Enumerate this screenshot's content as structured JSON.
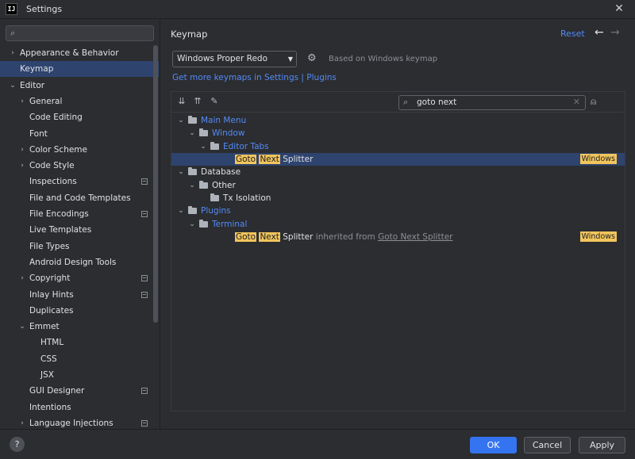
{
  "window": {
    "title": "Settings",
    "logo_text": "IJ",
    "close_glyph": "✕"
  },
  "sidebar": {
    "search_placeholder": "",
    "items": [
      {
        "label": "Appearance & Behavior",
        "level": 0,
        "arrow": "›",
        "badge": false,
        "selected": false
      },
      {
        "label": "Keymap",
        "level": 0,
        "arrow": "",
        "badge": false,
        "selected": true
      },
      {
        "label": "Editor",
        "level": 0,
        "arrow": "⌄",
        "badge": false,
        "selected": false
      },
      {
        "label": "General",
        "level": 1,
        "arrow": "›",
        "badge": false,
        "selected": false
      },
      {
        "label": "Code Editing",
        "level": 1,
        "arrow": "",
        "badge": false,
        "selected": false
      },
      {
        "label": "Font",
        "level": 1,
        "arrow": "",
        "badge": false,
        "selected": false
      },
      {
        "label": "Color Scheme",
        "level": 1,
        "arrow": "›",
        "badge": false,
        "selected": false
      },
      {
        "label": "Code Style",
        "level": 1,
        "arrow": "›",
        "badge": false,
        "selected": false
      },
      {
        "label": "Inspections",
        "level": 1,
        "arrow": "",
        "badge": true,
        "selected": false
      },
      {
        "label": "File and Code Templates",
        "level": 1,
        "arrow": "",
        "badge": false,
        "selected": false
      },
      {
        "label": "File Encodings",
        "level": 1,
        "arrow": "",
        "badge": true,
        "selected": false
      },
      {
        "label": "Live Templates",
        "level": 1,
        "arrow": "",
        "badge": false,
        "selected": false
      },
      {
        "label": "File Types",
        "level": 1,
        "arrow": "",
        "badge": false,
        "selected": false
      },
      {
        "label": "Android Design Tools",
        "level": 1,
        "arrow": "",
        "badge": false,
        "selected": false
      },
      {
        "label": "Copyright",
        "level": 1,
        "arrow": "›",
        "badge": true,
        "selected": false
      },
      {
        "label": "Inlay Hints",
        "level": 1,
        "arrow": "",
        "badge": true,
        "selected": false
      },
      {
        "label": "Duplicates",
        "level": 1,
        "arrow": "",
        "badge": false,
        "selected": false
      },
      {
        "label": "Emmet",
        "level": 1,
        "arrow": "⌄",
        "badge": false,
        "selected": false
      },
      {
        "label": "HTML",
        "level": 2,
        "arrow": "",
        "badge": false,
        "selected": false
      },
      {
        "label": "CSS",
        "level": 2,
        "arrow": "",
        "badge": false,
        "selected": false
      },
      {
        "label": "JSX",
        "level": 2,
        "arrow": "",
        "badge": false,
        "selected": false
      },
      {
        "label": "GUI Designer",
        "level": 1,
        "arrow": "",
        "badge": true,
        "selected": false
      },
      {
        "label": "Intentions",
        "level": 1,
        "arrow": "",
        "badge": false,
        "selected": false
      },
      {
        "label": "Language Injections",
        "level": 1,
        "arrow": "›",
        "badge": true,
        "selected": false
      }
    ]
  },
  "main": {
    "title": "Keymap",
    "reset": "Reset",
    "back_glyph": "←",
    "forward_glyph": "→",
    "keymap_selected": "Windows Proper Redo",
    "based_on": "Based on Windows keymap",
    "more_keymaps": "Get more keymaps in Settings | Plugins",
    "toolbar_icons": [
      "expand-all-icon",
      "collapse-all-icon",
      "edit-icon"
    ],
    "find_value": "goto next",
    "tree": [
      {
        "kind": "folder",
        "level": 0,
        "arrow": "⌄",
        "parts": [
          {
            "t": "Main Menu",
            "c": "blue"
          }
        ],
        "tag": "",
        "folder_icon": "menu"
      },
      {
        "kind": "folder",
        "level": 1,
        "arrow": "⌄",
        "parts": [
          {
            "t": "Window",
            "c": "blue"
          }
        ],
        "tag": ""
      },
      {
        "kind": "folder",
        "level": 2,
        "arrow": "⌄",
        "parts": [
          {
            "t": "Editor Tabs",
            "c": "blue"
          }
        ],
        "tag": ""
      },
      {
        "kind": "action",
        "level": 3,
        "arrow": "",
        "selected": true,
        "parts": [
          {
            "t": "Goto",
            "c": "hl"
          },
          {
            "t": " ",
            "c": ""
          },
          {
            "t": "Next",
            "c": "hl"
          },
          {
            "t": " Splitter",
            "c": ""
          }
        ],
        "tag": "Windows"
      },
      {
        "kind": "folder",
        "level": 0,
        "arrow": "⌄",
        "parts": [
          {
            "t": "Database",
            "c": ""
          }
        ],
        "tag": ""
      },
      {
        "kind": "folder",
        "level": 1,
        "arrow": "⌄",
        "parts": [
          {
            "t": "Other",
            "c": ""
          }
        ],
        "tag": "",
        "folder_icon": "grid"
      },
      {
        "kind": "folder",
        "level": 2,
        "arrow": "",
        "parts": [
          {
            "t": "Tx Isolation",
            "c": ""
          }
        ],
        "tag": ""
      },
      {
        "kind": "folder",
        "level": 0,
        "arrow": "⌄",
        "parts": [
          {
            "t": "Plugins",
            "c": "blue"
          }
        ],
        "tag": ""
      },
      {
        "kind": "folder",
        "level": 1,
        "arrow": "⌄",
        "parts": [
          {
            "t": "Terminal",
            "c": "blue"
          }
        ],
        "tag": ""
      },
      {
        "kind": "action",
        "level": 3,
        "arrow": "",
        "selected": false,
        "parts": [
          {
            "t": "Goto",
            "c": "hl"
          },
          {
            "t": " ",
            "c": ""
          },
          {
            "t": "Next",
            "c": "hl"
          },
          {
            "t": " Splitter",
            "c": ""
          },
          {
            "t": " inherited from ",
            "c": "dim"
          },
          {
            "t": "Goto Next Splitter",
            "c": "ul"
          }
        ],
        "tag": "Windows"
      }
    ]
  },
  "footer": {
    "help": "?",
    "ok": "OK",
    "cancel": "Cancel",
    "apply": "Apply"
  },
  "colors": {
    "background": "#2b2d30",
    "selection": "#2e436e",
    "link": "#548af7",
    "highlight": "#f2c55c",
    "primary_button": "#3574f0"
  }
}
